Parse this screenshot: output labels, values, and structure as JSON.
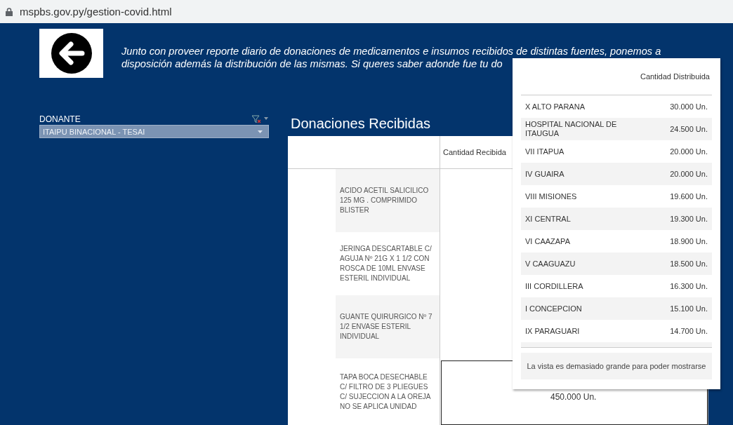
{
  "address_bar": {
    "url": "mspbs.gov.py/gestion-covid.html"
  },
  "intro": {
    "lines": [
      "Junto con proveer reporte diario de donaciones de medicamentos e insumos recibidos de distintas fuentes, ponemos a",
      "disposición además la distribución de las mismas. Si queres saber adonde fue tu do"
    ]
  },
  "filter": {
    "label": "DONANTE",
    "value": "ITAIPU BINACIONAL - TESAI"
  },
  "donations": {
    "title": "Donaciones Recibidas",
    "columns": [
      "Cantidad Recibida"
    ],
    "rows": [
      {
        "product": "ACIDO ACETIL SALICILICO 125 MG . COMPRIMIDO BLISTER",
        "selected": false
      },
      {
        "product": "JERINGA DESCARTABLE C/ AGUJA  Nº 21G X 1 1/2 CON ROSCA DE 10ML ENVASE ESTERIL INDIVIDUAL",
        "selected": false
      },
      {
        "product": "GUANTE QUIRURGICO  Nº 7 1/2 ENVASE ESTERIL INDIVIDUAL",
        "selected": false
      },
      {
        "product": "TAPA BOCA DESECHABLE C/ FILTRO DE 3 PLIEGUES C/ SUJECCION A LA OREJA  NO SE APLICA UNIDAD",
        "quantity": "450.000 Un.",
        "selected": true
      }
    ]
  },
  "tooltip": {
    "column": "Cantidad Distribuida",
    "rows": [
      {
        "region": "X ALTO PARANA",
        "amount": "30.000 Un."
      },
      {
        "region": "HOSPITAL NACIONAL DE ITAUGUA",
        "amount": "24.500 Un."
      },
      {
        "region": "VII ITAPUA",
        "amount": "20.000 Un."
      },
      {
        "region": "IV GUAIRA",
        "amount": "20.000 Un."
      },
      {
        "region": "VIII MISIONES",
        "amount": "19.600 Un."
      },
      {
        "region": "XI CENTRAL",
        "amount": "19.300 Un."
      },
      {
        "region": "VI  CAAZAPA",
        "amount": "18.900 Un."
      },
      {
        "region": "V CAAGUAZU",
        "amount": "18.500 Un."
      },
      {
        "region": "III CORDILLERA",
        "amount": "16.300 Un."
      },
      {
        "region": "I CONCEPCION",
        "amount": "15.100 Un."
      },
      {
        "region": "IX PARAGUARI",
        "amount": "14.700 Un."
      }
    ],
    "message": "La vista es demasiado grande para poder mostrarse"
  }
}
